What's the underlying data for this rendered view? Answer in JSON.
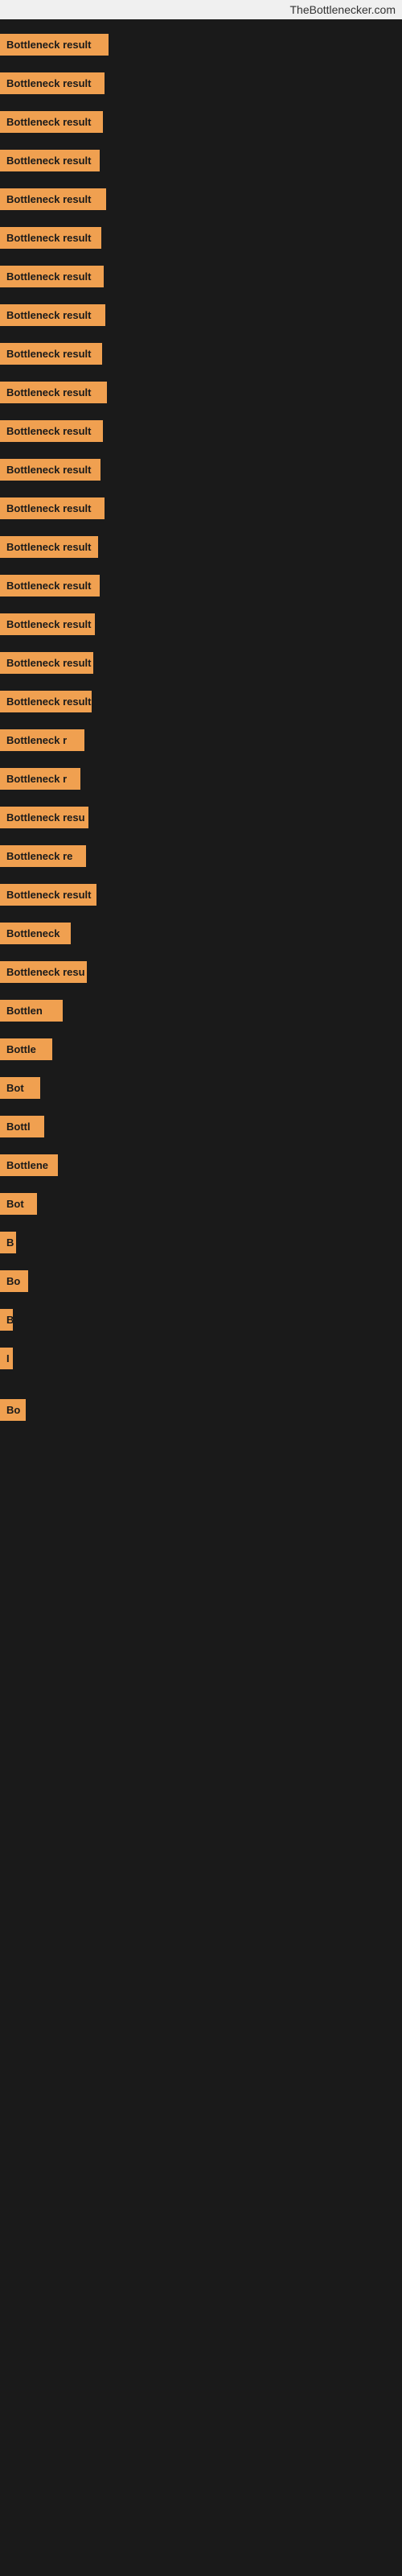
{
  "site": {
    "title": "TheBottlenecker.com"
  },
  "bars": [
    {
      "label": "Bottleneck result",
      "width": 135
    },
    {
      "label": "Bottleneck result",
      "width": 130
    },
    {
      "label": "Bottleneck result",
      "width": 128
    },
    {
      "label": "Bottleneck result",
      "width": 124
    },
    {
      "label": "Bottleneck result",
      "width": 132
    },
    {
      "label": "Bottleneck result",
      "width": 126
    },
    {
      "label": "Bottleneck result",
      "width": 129
    },
    {
      "label": "Bottleneck result",
      "width": 131
    },
    {
      "label": "Bottleneck result",
      "width": 127
    },
    {
      "label": "Bottleneck result",
      "width": 133
    },
    {
      "label": "Bottleneck result",
      "width": 128
    },
    {
      "label": "Bottleneck result",
      "width": 125
    },
    {
      "label": "Bottleneck result",
      "width": 130
    },
    {
      "label": "Bottleneck result",
      "width": 122
    },
    {
      "label": "Bottleneck result",
      "width": 124
    },
    {
      "label": "Bottleneck result",
      "width": 118
    },
    {
      "label": "Bottleneck result",
      "width": 116
    },
    {
      "label": "Bottleneck result",
      "width": 114
    },
    {
      "label": "Bottleneck r",
      "width": 105
    },
    {
      "label": "Bottleneck r",
      "width": 100
    },
    {
      "label": "Bottleneck resu",
      "width": 110
    },
    {
      "label": "Bottleneck re",
      "width": 107
    },
    {
      "label": "Bottleneck result",
      "width": 120
    },
    {
      "label": "Bottleneck",
      "width": 88
    },
    {
      "label": "Bottleneck resu",
      "width": 108
    },
    {
      "label": "Bottlen",
      "width": 78
    },
    {
      "label": "Bottle",
      "width": 65
    },
    {
      "label": "Bot",
      "width": 50
    },
    {
      "label": "Bottl",
      "width": 55
    },
    {
      "label": "Bottlene",
      "width": 72
    },
    {
      "label": "Bot",
      "width": 46
    },
    {
      "label": "B",
      "width": 20
    },
    {
      "label": "Bo",
      "width": 35
    },
    {
      "label": "B",
      "width": 16
    },
    {
      "label": "I",
      "width": 10
    },
    {
      "label": "",
      "width": 0
    },
    {
      "label": "Bo",
      "width": 32
    }
  ]
}
